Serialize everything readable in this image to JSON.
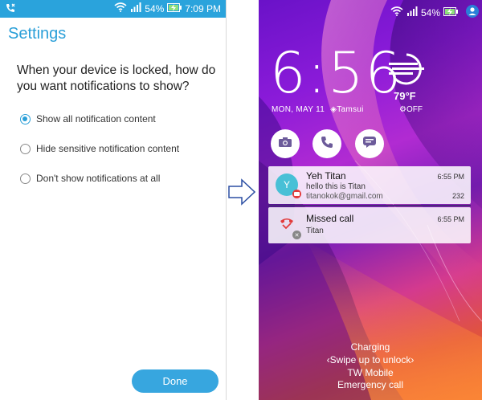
{
  "left_phone": {
    "status_bar": {
      "battery": "54%",
      "time": "7:09 PM"
    },
    "title": "Settings",
    "question": "When your device is locked, how do you want notifications to show?",
    "options": [
      {
        "label": "Show all notification content",
        "selected": true
      },
      {
        "label": "Hide sensitive notification content",
        "selected": false
      },
      {
        "label": "Don't show notifications at all",
        "selected": false
      }
    ],
    "done_label": "Done"
  },
  "right_phone": {
    "status_bar": {
      "battery": "54%"
    },
    "clock": "6:56",
    "date": "MON, MAY 11",
    "location": "Tamsui",
    "temperature": "79°F",
    "weather_status": "OFF",
    "notifications": [
      {
        "avatar_letter": "Y",
        "name": "Yeh Titan",
        "message": "hello this is Titan",
        "email": "titanokok@gmail.com",
        "count": "232",
        "time": "6:55 PM"
      },
      {
        "name": "Missed call",
        "caller": "Titan",
        "time": "6:55 PM"
      }
    ],
    "bottom": {
      "charging": "Charging",
      "swipe": "Swipe up to unlock",
      "carrier": "TW Mobile",
      "emergency": "Emergency call"
    }
  },
  "colors": {
    "accent": "#2a9fd8",
    "status_bar": "#2aa3dc",
    "done_button": "#37a6df"
  }
}
